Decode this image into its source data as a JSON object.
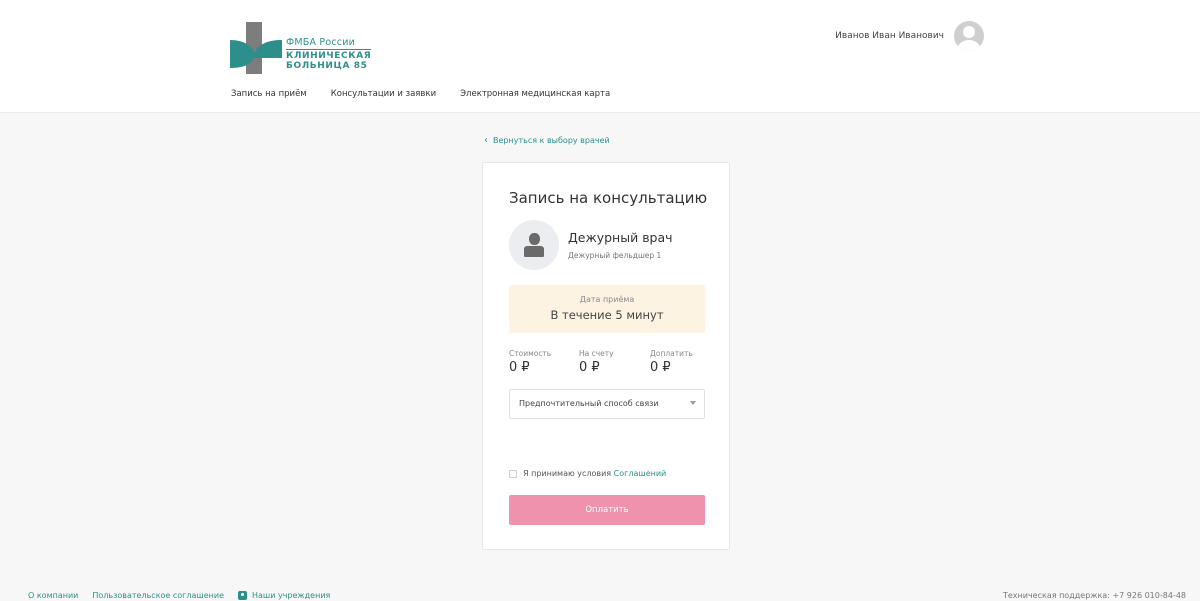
{
  "brand": {
    "line1": "ФМБА России",
    "line2": "КЛИНИЧЕСКАЯ",
    "line3": "БОЛЬНИЦА 85",
    "colors": {
      "teal": "#2c8f8b",
      "grey": "#7a7a7a"
    }
  },
  "user": {
    "name": "Иванов Иван Иванович"
  },
  "nav": {
    "items": [
      {
        "label": "Запись на приём"
      },
      {
        "label": "Консультации и заявки"
      },
      {
        "label": "Электронная медицинская карта"
      }
    ]
  },
  "back_link": {
    "label": "Вернуться к выбору врачей",
    "icon": "chevron-left-icon"
  },
  "card": {
    "title": "Запись на консультацию",
    "doctor": {
      "name": "Дежурный врач",
      "role": "Дежурный фельдшер 1"
    },
    "date": {
      "label": "Дата приёма",
      "value": "В течение 5 минут"
    },
    "prices": [
      {
        "label": "Стоимость",
        "value": "0 ₽"
      },
      {
        "label": "На счету",
        "value": "0 ₽"
      },
      {
        "label": "Доплатить",
        "value": "0 ₽"
      }
    ],
    "contact_select": {
      "value": "Предпочтительный способ связи"
    },
    "agreement": {
      "text": "Я принимаю условия ",
      "link": "Соглашений",
      "checked": false
    },
    "pay_button": {
      "label": "Оплатить",
      "color": "#ee92ad"
    }
  },
  "footer": {
    "links": [
      {
        "label": "О компании"
      },
      {
        "label": "Пользовательское соглашение"
      },
      {
        "label": "Наши учреждения",
        "icon": "location-icon"
      }
    ],
    "support": "Техническая поддержка: +7 926 010-84-48"
  }
}
